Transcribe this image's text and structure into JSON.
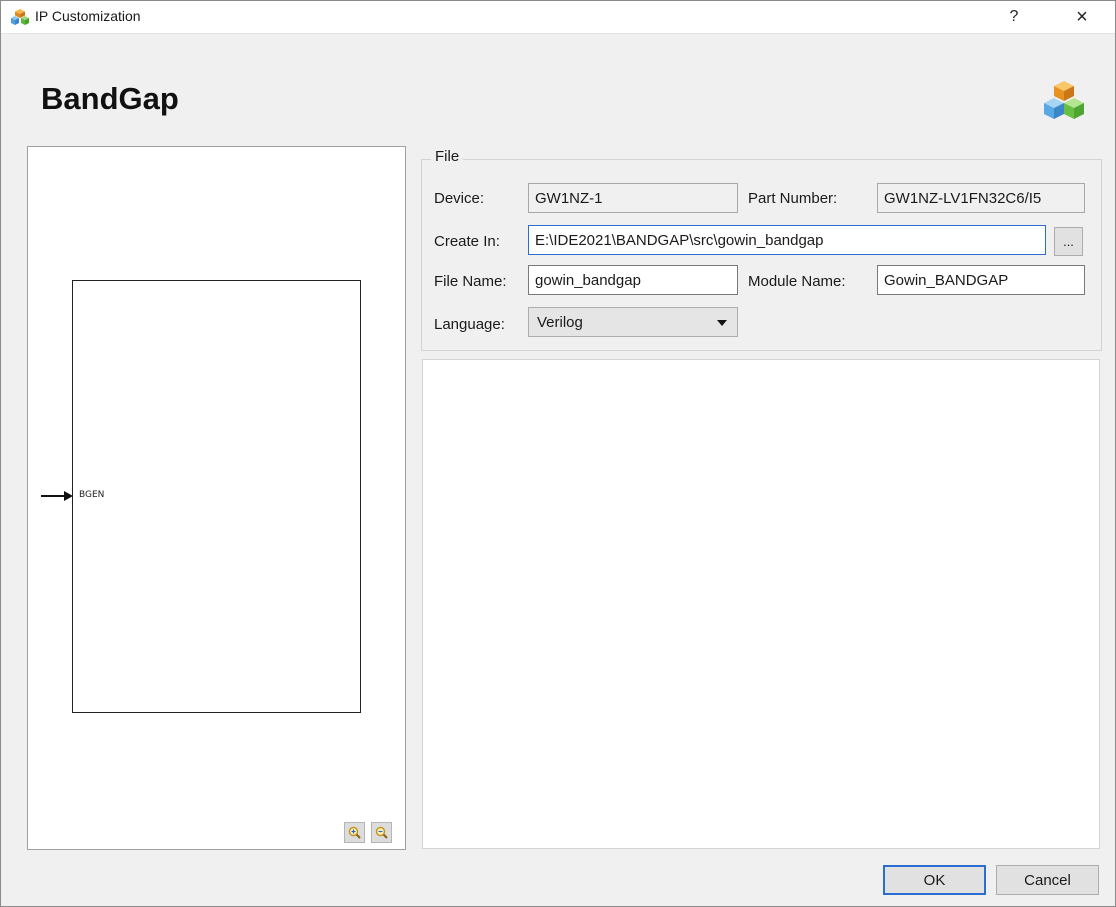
{
  "window": {
    "title": "IP Customization",
    "help_label": "?",
    "close_label": "×"
  },
  "header": {
    "title": "BandGap"
  },
  "preview": {
    "port_label": "BGEN"
  },
  "file_group": {
    "label": "File",
    "device_label": "Device:",
    "device_value": "GW1NZ-1",
    "part_number_label": "Part Number:",
    "part_number_value": "GW1NZ-LV1FN32C6/I5",
    "create_in_label": "Create In:",
    "create_in_value": "E:\\IDE2021\\BANDGAP\\src\\gowin_bandgap",
    "browse_label": "...",
    "file_name_label": "File Name:",
    "file_name_value": "gowin_bandgap",
    "module_name_label": "Module Name:",
    "module_name_value": "Gowin_BANDGAP",
    "language_label": "Language:",
    "language_value": "Verilog"
  },
  "buttons": {
    "ok": "OK",
    "cancel": "Cancel"
  },
  "icons": {
    "app": "cubes-icon",
    "header": "cubes-icon",
    "zoom_in": "zoom-in-icon",
    "zoom_out": "zoom-out-icon"
  }
}
